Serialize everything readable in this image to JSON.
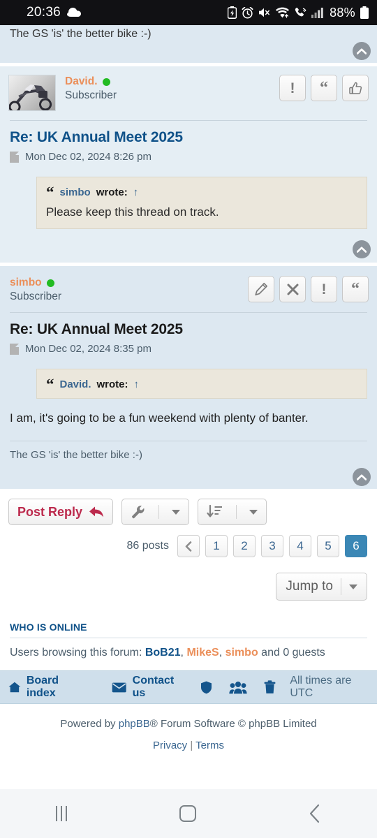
{
  "status_bar": {
    "clock": "20:36",
    "battery_percent": "88%",
    "icons": [
      "cloud-icon",
      "battery-saver-icon",
      "alarm-icon",
      "mute-icon",
      "wifi-icon",
      "call-wifi-icon",
      "signal-bars-icon",
      "battery-icon"
    ]
  },
  "prev_post_tail": {
    "signature": "The GS 'is' the better bike :-)"
  },
  "posts": [
    {
      "author": "David.",
      "rank": "Subscriber",
      "online": true,
      "avatar_alt": "motorcycle-avatar",
      "title": "Re: UK Annual Meet 2025",
      "title_link": true,
      "date": "Mon Dec 02, 2024 8:26 pm",
      "buttons": [
        "report-button",
        "quote-button",
        "like-button"
      ],
      "quote": {
        "author": "simbo",
        "wrote_label": "wrote:",
        "jump_arrow": "↑",
        "text": "Please keep this thread on track."
      },
      "body": "",
      "signature": ""
    },
    {
      "author": "simbo",
      "rank": "Subscriber",
      "online": true,
      "title": "Re: UK Annual Meet 2025",
      "title_link": false,
      "date": "Mon Dec 02, 2024 8:35 pm",
      "buttons": [
        "edit-button",
        "delete-button",
        "report-button",
        "quote-button"
      ],
      "quote": {
        "author": "David.",
        "wrote_label": "wrote:",
        "jump_arrow": "↑",
        "text": ""
      },
      "body": "I am, it's going to be a fun weekend with plenty of banter.",
      "signature": "The GS 'is' the better bike :-)"
    }
  ],
  "action_bar": {
    "post_reply_label": "Post Reply",
    "topic_tools_icon": "wrench-icon",
    "sort_icon": "sort-amount-down-icon"
  },
  "pagination": {
    "posts_count": "86 posts",
    "prev_label": "‹",
    "pages": [
      "1",
      "2",
      "3",
      "4",
      "5",
      "6"
    ],
    "active_page": "6",
    "active_color": "#3b87b5"
  },
  "jump_to": {
    "label": "Jump to"
  },
  "who_is_online": {
    "title": "WHO IS ONLINE",
    "prefix": "Users browsing this forum:",
    "users": [
      {
        "name": "BoB21",
        "color": "blue"
      },
      {
        "name": "MikeS",
        "color": "orange"
      },
      {
        "name": "simbo",
        "color": "orange"
      }
    ],
    "separator": ", ",
    "suffix": "and 0 guests"
  },
  "footer_nav": {
    "board_index": "Board index",
    "contact_us": "Contact us",
    "times": "All times are UTC",
    "icons": [
      "home-icon",
      "envelope-icon",
      "shield-icon",
      "members-icon",
      "trash-icon"
    ]
  },
  "footer": {
    "powered_prefix": "Powered by ",
    "phpbb": "phpBB",
    "powered_suffix": "® Forum Software © phpBB Limited",
    "privacy": "Privacy",
    "divider": "|",
    "terms": "Terms"
  },
  "nav_bar": {
    "recent_apps": "recent-apps-icon",
    "home": "home-icon",
    "back": "back-icon"
  }
}
